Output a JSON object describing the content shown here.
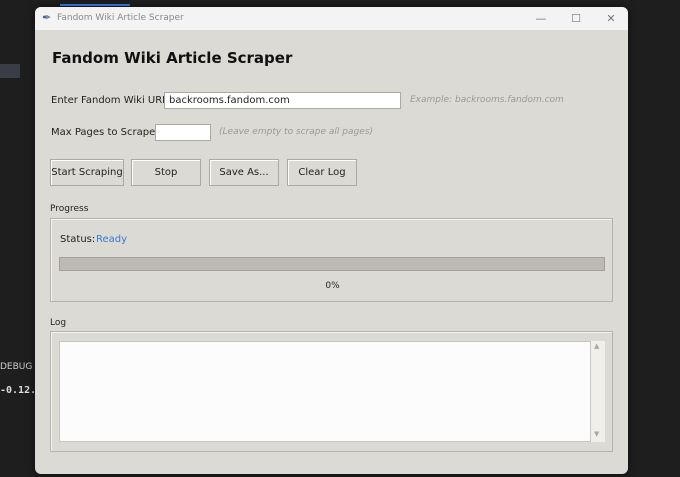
{
  "background": {
    "debug_text": "DEBUG CO",
    "terminal_text": "-0.12."
  },
  "window": {
    "title": "Fandom Wiki Article Scraper",
    "minimize": "—",
    "maximize": "☐",
    "close": "✕"
  },
  "heading": "Fandom Wiki Article Scraper",
  "url": {
    "label": "Enter Fandom Wiki URL:",
    "value": "backrooms.fandom.com",
    "hint": "Example: backrooms.fandom.com"
  },
  "max_pages": {
    "label": "Max Pages to Scrape:",
    "value": "",
    "hint": "(Leave empty to scrape all pages)"
  },
  "buttons": {
    "start": "Start Scraping",
    "stop": "Stop",
    "save": "Save As...",
    "clear": "Clear Log"
  },
  "progress": {
    "section_label": "Progress",
    "status_label": "Status:",
    "status_value": "Ready",
    "percent": 0,
    "percent_text": "0%",
    "status_color": "#3a7bd5"
  },
  "log": {
    "section_label": "Log",
    "content": ""
  }
}
